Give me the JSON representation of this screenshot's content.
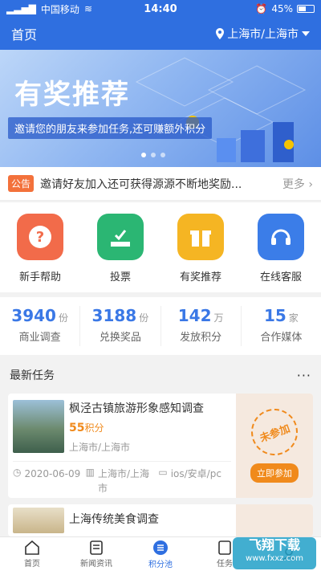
{
  "statusbar": {
    "carrier": "中国移动",
    "time": "14:40",
    "battery": "45%"
  },
  "navbar": {
    "title": "首页",
    "location": "上海市/上海市"
  },
  "banner": {
    "title": "有奖推荐",
    "subtitle": "邀请您的朋友来参加任务,还可赚额外积分"
  },
  "announce": {
    "tag": "公告",
    "text": "邀请好友加入还可获得源源不断地奖励...",
    "more": "更多"
  },
  "quick": [
    {
      "label": "新手帮助",
      "icon": "question-icon",
      "color": "#f26b4a"
    },
    {
      "label": "投票",
      "icon": "vote-icon",
      "color": "#2bb673"
    },
    {
      "label": "有奖推荐",
      "icon": "gift-icon",
      "color": "#f5b523"
    },
    {
      "label": "在线客服",
      "icon": "headset-icon",
      "color": "#3b7de8"
    }
  ],
  "stats": [
    {
      "value": "3940",
      "unit": "份",
      "label": "商业调查"
    },
    {
      "value": "3188",
      "unit": "份",
      "label": "兑换奖品"
    },
    {
      "value": "142",
      "unit": "万",
      "label": "发放积分"
    },
    {
      "value": "15",
      "unit": "家",
      "label": "合作媒体"
    }
  ],
  "section": {
    "title": "最新任务",
    "more": "···"
  },
  "tasks": [
    {
      "title": "枫泾古镇旅游形象感知调查",
      "points": "55",
      "points_unit": "积分",
      "location": "上海市/上海市",
      "date": "2020-06-09",
      "area": "上海市/上海市",
      "platform": "ios/安卓/pc",
      "status": "未参加",
      "action": "立即参加"
    },
    {
      "title": "上海传统美食调查"
    }
  ],
  "tabs": [
    {
      "label": "首页"
    },
    {
      "label": "新闻资讯"
    },
    {
      "label": "积分池"
    },
    {
      "label": "任务"
    }
  ],
  "watermark": {
    "text": "飞翔下载",
    "sub": "www.fxxz.com"
  }
}
